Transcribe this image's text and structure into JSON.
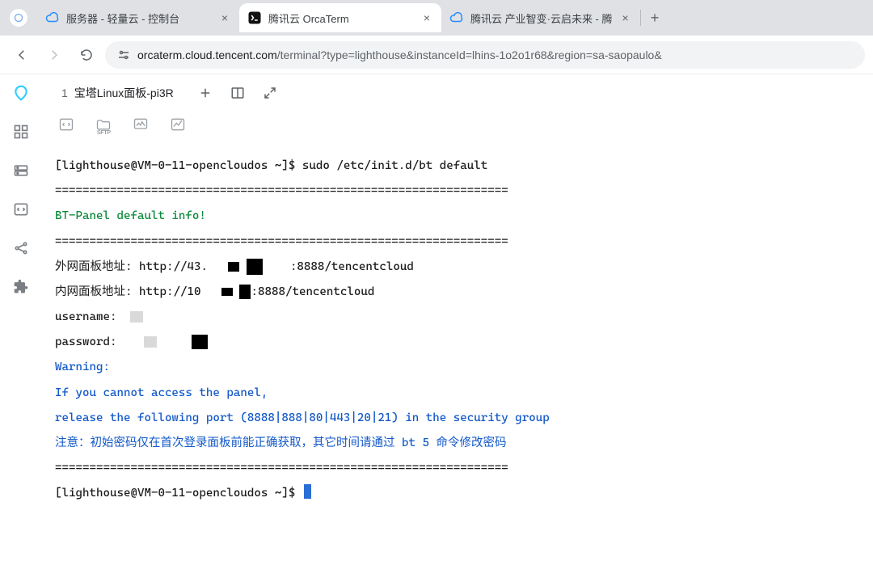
{
  "browser": {
    "tabs": [
      {
        "title": "服务器 - 轻量云 - 控制台",
        "active": false
      },
      {
        "title": "腾讯云 OrcaTerm",
        "active": true
      },
      {
        "title": "腾讯云 产业智变·云启未来 - 腾",
        "active": false
      }
    ],
    "url_host": "orcaterm.cloud.tencent.com",
    "url_path": "/terminal?type=lighthouse&instanceId=lhins-1o2o1r68&region=sa-saopaulo&"
  },
  "workspace": {
    "tab_number": "1",
    "tab_label": "宝塔Linux面板-pi3R"
  },
  "terminal": {
    "prompt1_user": "[lighthouse@VM-0-11-opencloudos ~]$ ",
    "command1": "sudo /etc/init.d/bt default",
    "divider": "==================================================================",
    "title_line": "BT-Panel default info!",
    "ext_label": "外网面板地址: http://43.",
    "ext_suffix": ":8888/tencentcloud",
    "int_label": "内网面板地址: http://10",
    "int_suffix": ":8888/tencentcloud",
    "username_label": "username:",
    "password_label": "password:",
    "warning_label": "Warning:",
    "warn1": "If you cannot access the panel,",
    "warn2": "release the following port (8888|888|80|443|20|21) in the security group",
    "note_cn_a": "注意：初始密码仅在首次登录面板前能正确获取，其它时间请通过 ",
    "note_cn_cmd": "bt 5",
    "note_cn_b": " 命令修改密码",
    "prompt2": "[lighthouse@VM-0-11-opencloudos ~]$ "
  }
}
